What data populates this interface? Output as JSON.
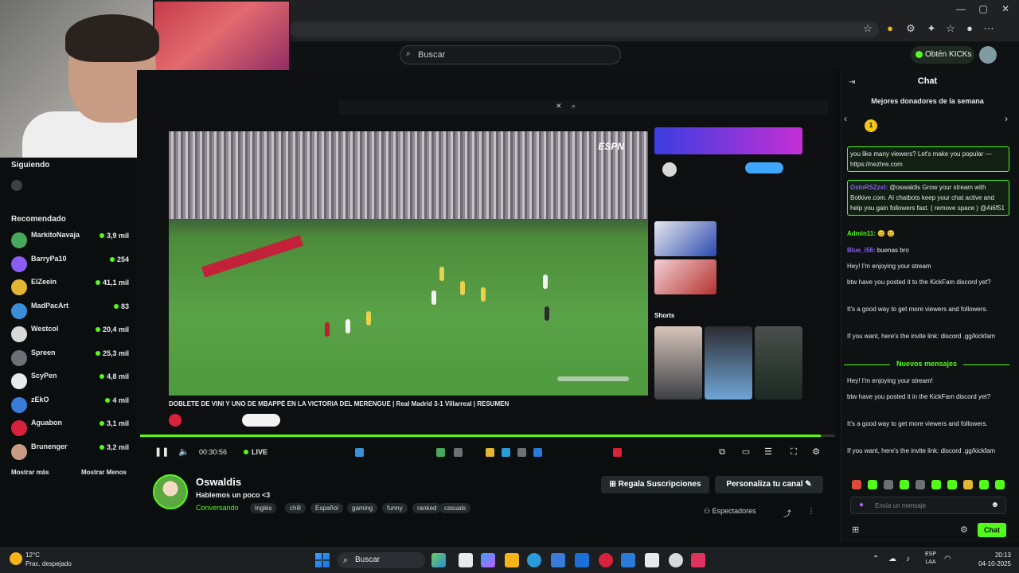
{
  "search": {
    "placeholder": "Buscar"
  },
  "header": {
    "get_kicks_label": "Obtén KICKs"
  },
  "sidebar": {
    "following_heading": "Siguiendo",
    "recommended_heading": "Recomendado",
    "show_more": "Mostrar más",
    "show_less": "Mostrar Menos",
    "channels": [
      {
        "name": "MarkitoNavaja",
        "viewers": "3,9 mil"
      },
      {
        "name": "BarryPa10",
        "viewers": "254"
      },
      {
        "name": "ElZeein",
        "viewers": "41,1 mil"
      },
      {
        "name": "MadPacArt",
        "viewers": "83"
      },
      {
        "name": "Westcol",
        "viewers": "20,4 mil"
      },
      {
        "name": "Spreen",
        "viewers": "25,3 mil"
      },
      {
        "name": "ScyPen",
        "viewers": "4,8 mil"
      },
      {
        "name": "zEkO",
        "viewers": "4 mil"
      },
      {
        "name": "Aguabon",
        "viewers": "3,1 mil"
      },
      {
        "name": "Brunenger",
        "viewers": "3,2 mil"
      }
    ]
  },
  "video": {
    "network_logo": "ESPN",
    "youtube_title": "DOBLETE DE VINI Y UNO DE MBAPPÉ EN LA VICTORIA DEL MERENGUE | Real Madrid 3-1 Villarreal | RESUMEN",
    "shorts_label": "Shorts"
  },
  "player": {
    "time": "00:30:56",
    "live_label": "LIVE",
    "progress": 0.98
  },
  "stream": {
    "channel_name": "Oswaldis",
    "title": "Hablemos un poco <3",
    "category": "Conversando",
    "tags": [
      "Inglés",
      "chill",
      "Español",
      "gaming",
      "funny",
      "ranked",
      "casuals"
    ],
    "subs_button": "Regala Suscripciones",
    "customize_button": "Personaliza tu canal",
    "viewers_label": "Espectadores"
  },
  "chat": {
    "title": "Chat",
    "top_donors": "Mejores donadores de la semana",
    "donor_rank": "1",
    "messages": [
      {
        "user": "",
        "text": "you like many viewers? Let's make you popular — https://nezhre.com",
        "highlight": true
      },
      {
        "user": "OsloRSZzxl:",
        "text": "@oswaldis Grow your stream with Botkive.com. AI chatbots keep your chat active and help you gain followers fast. ( remove space ) @Ai6f51",
        "highlight": true
      },
      {
        "user": "Admin11:",
        "text": "😊 😊",
        "highlight": false
      },
      {
        "user": "Blue_i56:",
        "text": "buenas bro",
        "highlight": false
      },
      {
        "user": "",
        "text": "Hey! I'm enjoying your stream",
        "highlight": false
      },
      {
        "user": "",
        "text": "btw have you posted it to the KickFam discord yet?",
        "highlight": false
      },
      {
        "user": "",
        "text": "It's a good way to get more viewers and followers.",
        "highlight": false
      },
      {
        "user": "",
        "text": "If you want, here's the invite link: discord .gg/kickfam",
        "highlight": false
      }
    ],
    "new_messages_label": "Nuevos mensajes",
    "new_messages": [
      {
        "user": "",
        "text": "Hey! I'm enjoying your stream!"
      },
      {
        "user": "",
        "text": "btw have you posted it in the KickFam discord yet?"
      },
      {
        "user": "",
        "text": "It's a good way to get more viewers and followers."
      },
      {
        "user": "",
        "text": "If you want, here's the invite link: discord .gg/kickfam"
      }
    ],
    "input_placeholder": "Envía un mensaje",
    "send_label": "Chat"
  },
  "taskbar": {
    "temperature": "12°C",
    "weather": "Prac. despejado",
    "search_label": "Buscar",
    "lang_1": "ESP",
    "lang_2": "LAA",
    "time": "20:13",
    "date": "04-10-2025"
  },
  "colors": {
    "kick_green": "#53fc18",
    "background": "#0b0e0f",
    "chat_bg": "#0f1213"
  },
  "icons": [
    "search-icon",
    "star-icon",
    "extensions-icon",
    "profile-icon",
    "menu-icon",
    "play-icon",
    "volume-icon",
    "fullscreen-icon",
    "settings-icon",
    "share-icon",
    "windows-icon"
  ]
}
